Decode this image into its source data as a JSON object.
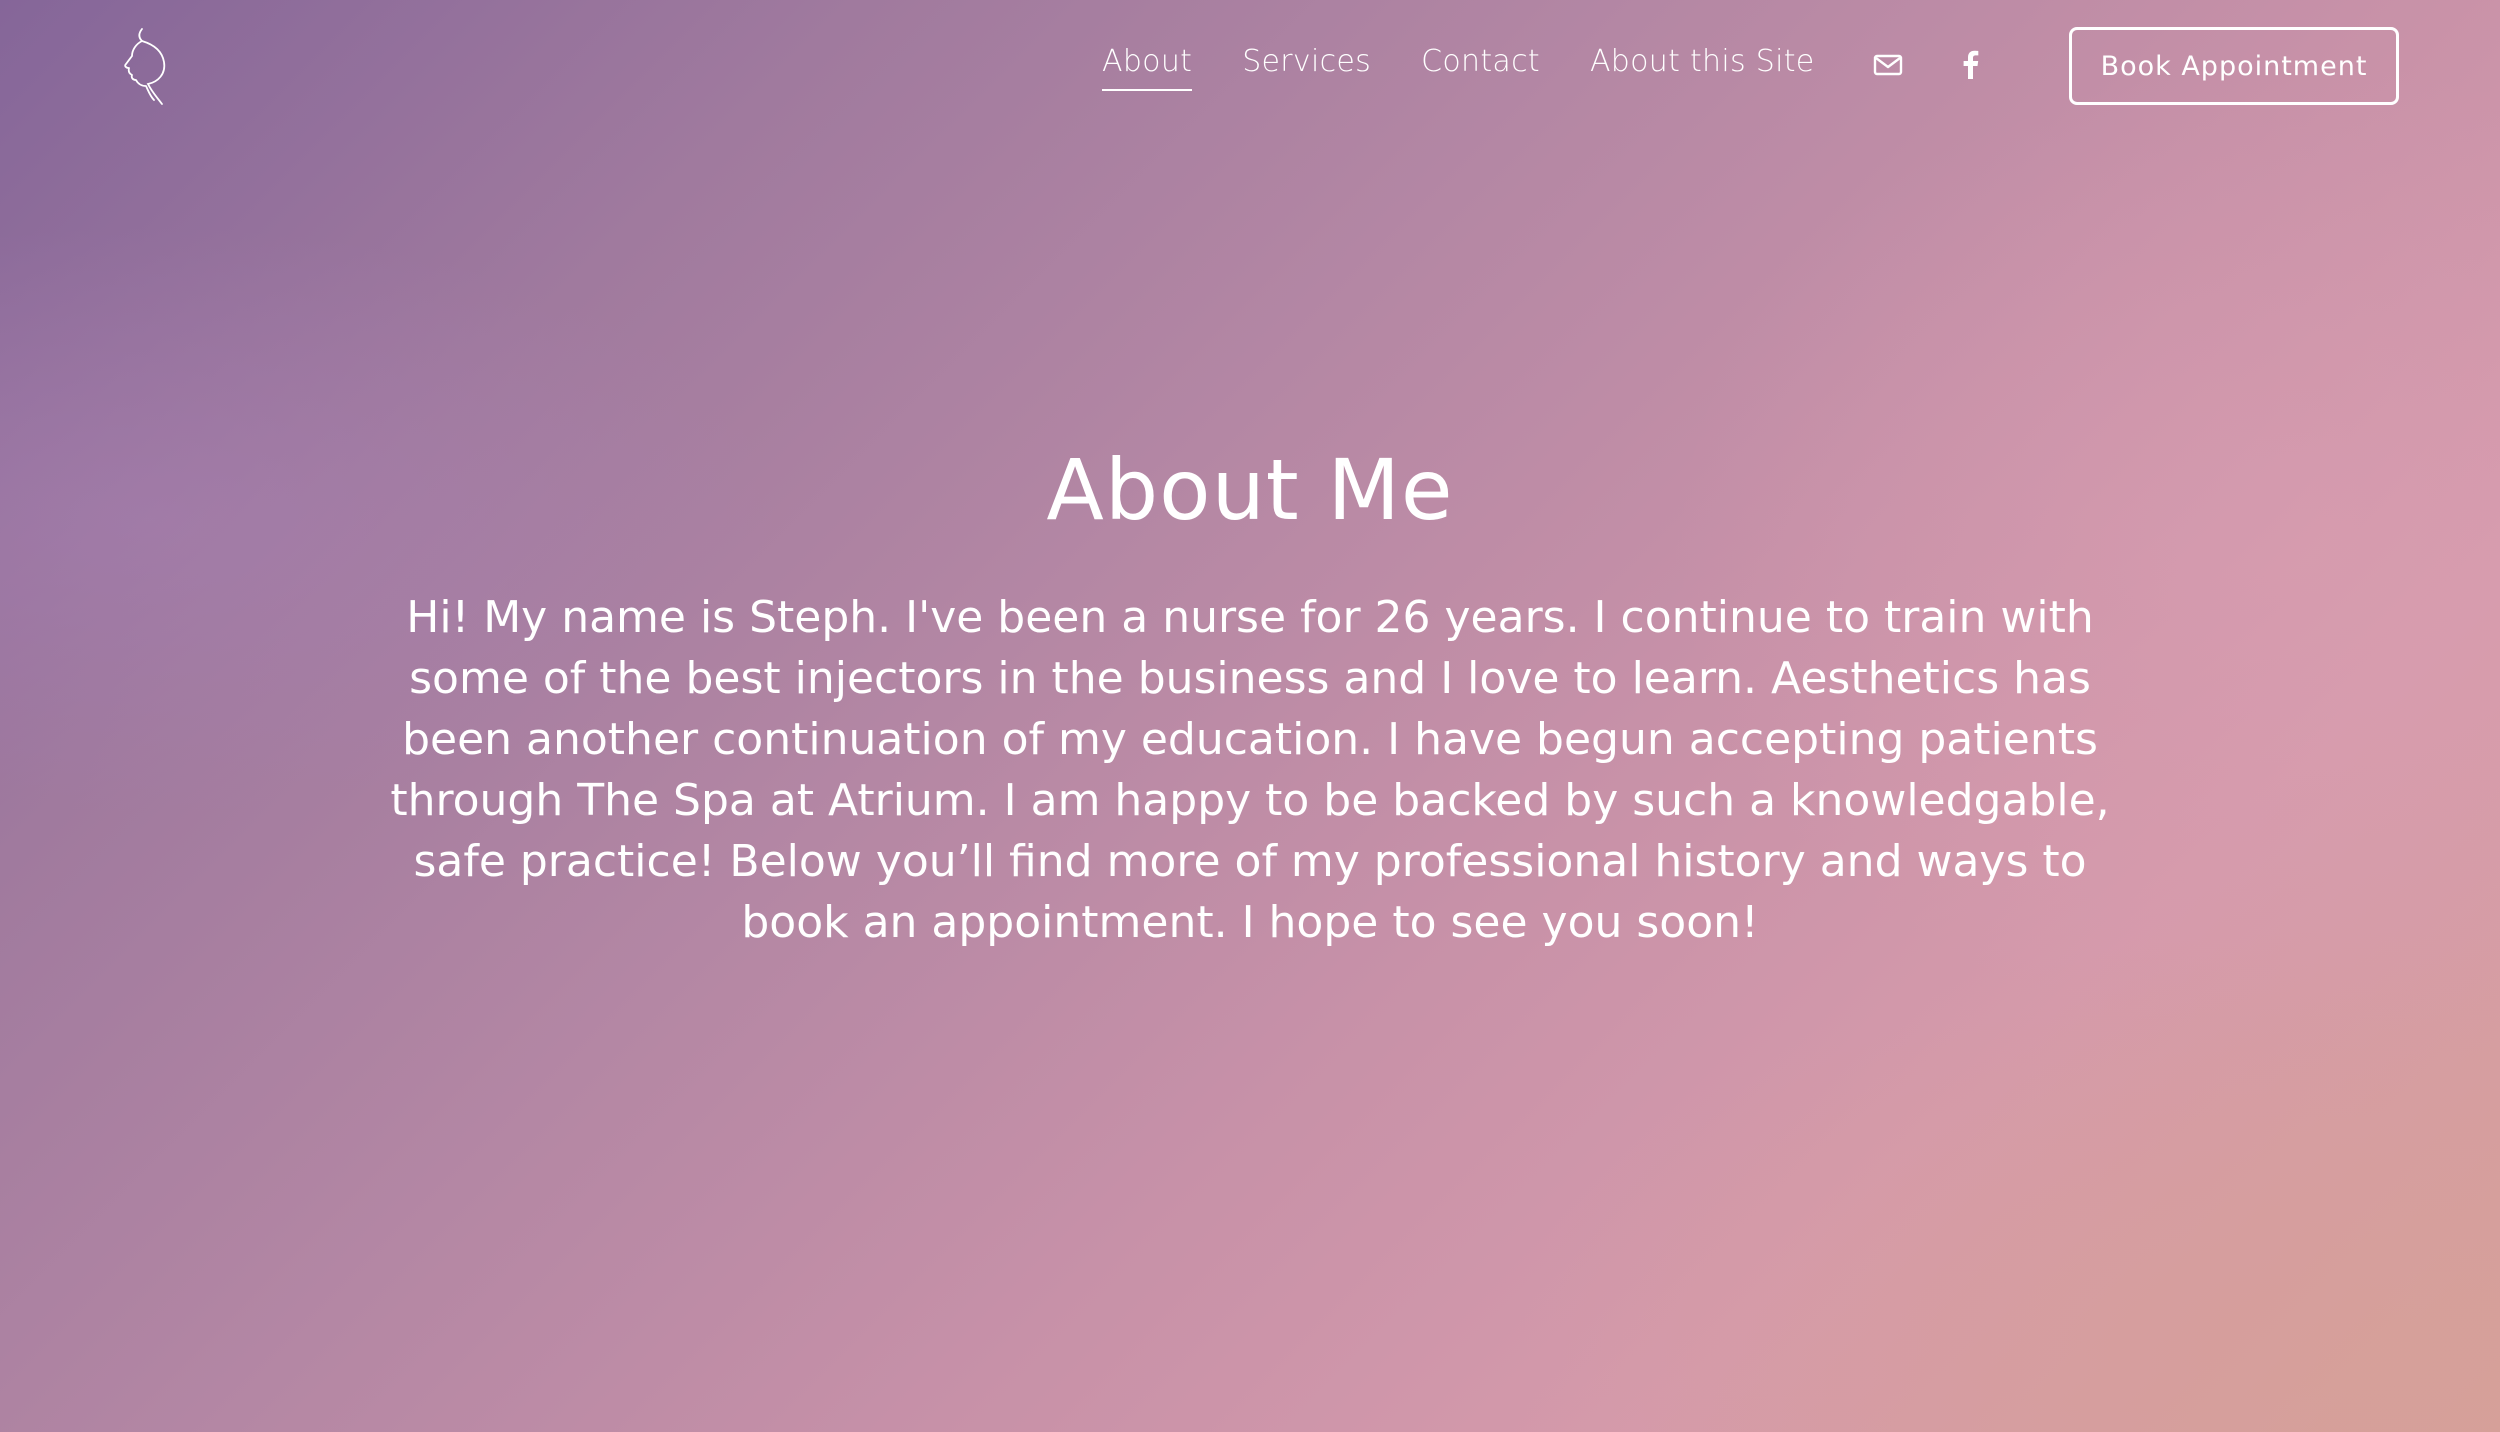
{
  "header": {
    "logo_icon": "face-profile-logo-icon",
    "nav": [
      {
        "label": "About",
        "active": true
      },
      {
        "label": "Services",
        "active": false
      },
      {
        "label": "Contact",
        "active": false
      },
      {
        "label": "About this Site",
        "active": false
      }
    ],
    "social": [
      {
        "icon": "email-icon"
      },
      {
        "icon": "facebook-icon"
      }
    ],
    "cta_label": "Book Appointment"
  },
  "main": {
    "title": "About Me",
    "body": "Hi! My name is Steph. I've been a nurse for 26 years. I continue to train with some of the best injectors in the business and I love to learn. Aesthetics has been another continuation of my education. I have begun accepting patients through The Spa at Atrium. I am happy to be backed by such a knowledgable, safe practice! Below you’ll find more of my professional history and ways to book an appointment. I hope to see you soon!"
  },
  "colors": {
    "text": "#ffffff",
    "gradient_start": "#856699",
    "gradient_mid": "#c791a8",
    "gradient_end": "#d6a09b"
  }
}
